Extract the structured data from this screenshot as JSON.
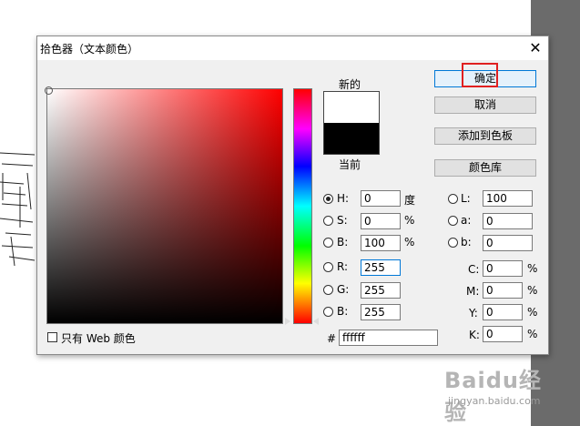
{
  "dialog": {
    "title": "拾色器（文本颜色）",
    "close_glyph": "✕"
  },
  "preview": {
    "new_label": "新的",
    "current_label": "当前",
    "new_color": "#ffffff",
    "current_color": "#000000"
  },
  "buttons": {
    "ok": "确定",
    "cancel": "取消",
    "add_swatch": "添加到色板",
    "libraries": "颜色库"
  },
  "hsb": {
    "h_label": "H:",
    "h_value": "0",
    "h_unit": "度",
    "s_label": "S:",
    "s_value": "0",
    "s_unit": "%",
    "b_label": "B:",
    "b_value": "100",
    "b_unit": "%"
  },
  "rgb": {
    "r_label": "R:",
    "r_value": "255",
    "g_label": "G:",
    "g_value": "255",
    "b_label": "B:",
    "b_value": "255"
  },
  "lab": {
    "l_label": "L:",
    "l_value": "100",
    "a_label": "a:",
    "a_value": "0",
    "b_label": "b:",
    "b_value": "0"
  },
  "cmyk": {
    "c_label": "C:",
    "c_value": "0",
    "m_label": "M:",
    "m_value": "0",
    "y_label": "Y:",
    "y_value": "0",
    "k_label": "K:",
    "k_value": "0",
    "unit": "%"
  },
  "hex": {
    "label": "#",
    "value": "ffffff"
  },
  "web_only": {
    "label": "只有 Web 颜色"
  },
  "watermark": {
    "line1": "Baidu经验",
    "line2": "jingyan.baidu.com"
  },
  "colors": {
    "accent": "#0078d7",
    "highlight": "#e02020",
    "dialog_bg": "#f0f0f0"
  }
}
